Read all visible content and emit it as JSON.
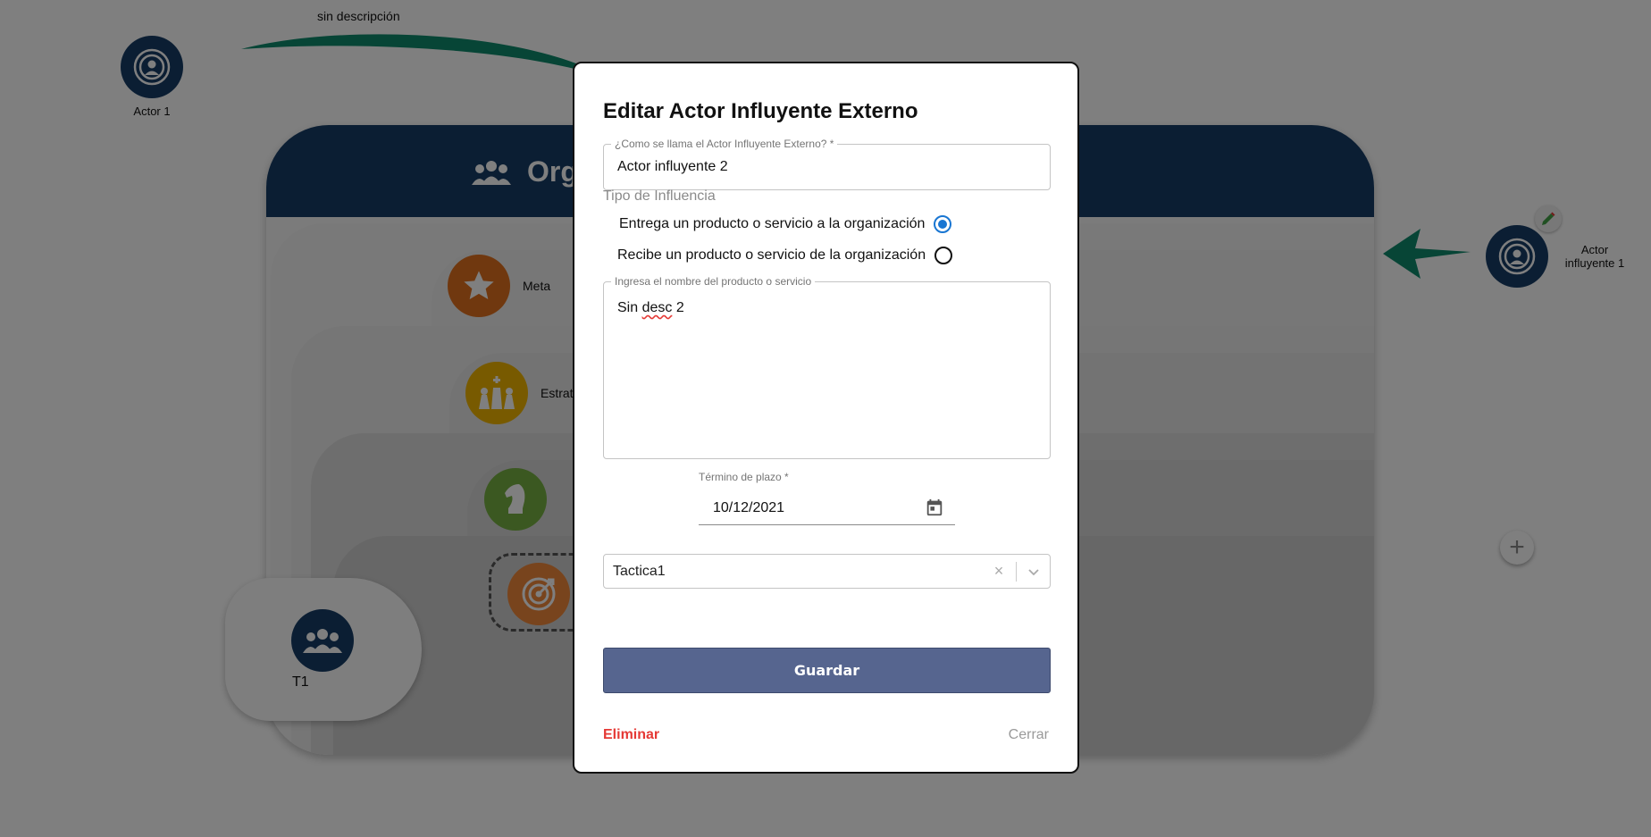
{
  "background": {
    "top_label": "sin descripción",
    "actor_left_label": "Actor 1",
    "org_title": "Organización",
    "meta_label": "Meta",
    "estrategia_label": "Estrategia",
    "team_label": "T1",
    "actor_right_label_line1": "Actor",
    "actor_right_label_line2": "influyente 1",
    "colors": {
      "navy": "#163d66",
      "green_arrow": "#0e8a6c",
      "meta_orange": "#e0701e",
      "strategy_yellow": "#f0b400",
      "tactic_green": "#76b043",
      "target_orange": "#f0883a"
    }
  },
  "modal": {
    "title": "Editar Actor Influyente Externo",
    "name_field": {
      "label": "¿Como se llama el Actor Influyente Externo? *",
      "value": "Actor influyente 2"
    },
    "tipo_label": "Tipo de Influencia",
    "radio_options": [
      {
        "label": "Entrega un producto o servicio a la organización",
        "checked": true
      },
      {
        "label": "Recibe un producto o servicio de la organización",
        "checked": false
      }
    ],
    "product_field": {
      "label": "Ingresa el nombre del producto o servicio",
      "value_prefix": "Sin ",
      "value_misspelled": "desc",
      "value_suffix": " 2"
    },
    "date_field": {
      "label": "Término de plazo *",
      "value": "10/12/2021"
    },
    "tactica_select": {
      "value": "Tactica1",
      "clear_glyph": "×"
    },
    "save_label": "Guardar",
    "delete_label": "Eliminar",
    "close_label": "Cerrar",
    "colors": {
      "save_bg": "#56658f",
      "delete_red": "#e53935",
      "radio_blue": "#1976d2"
    }
  }
}
